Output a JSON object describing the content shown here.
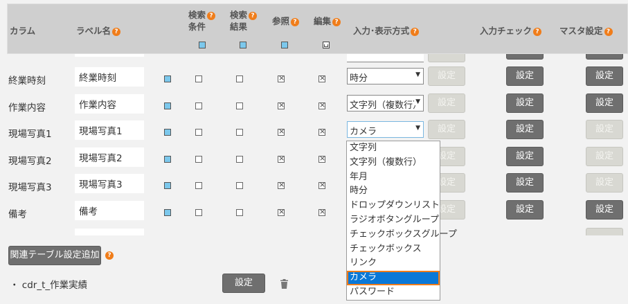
{
  "header": {
    "column": "カラム",
    "label_name": "ラベル名",
    "search_condition": [
      "検索",
      "条件"
    ],
    "search_result": [
      "検索",
      "結果"
    ],
    "reference": "参照",
    "edit": "編集",
    "input_display": "入力･表示方式",
    "input_check": "入力チェック",
    "master_setting": "マスタ設定",
    "help": "?"
  },
  "rows": [
    {
      "column": "終業時刻",
      "label": "終業時刻",
      "type": "時分",
      "setting_enabled": false,
      "input_check_enabled": true,
      "master_enabled": true
    },
    {
      "column": "作業内容",
      "label": "作業内容",
      "type": "文字列（複数行）",
      "setting_enabled": false,
      "input_check_enabled": true,
      "master_enabled": true
    },
    {
      "column": "現場写真1",
      "label": "現場写真1",
      "type": "カメラ",
      "setting_enabled": false,
      "input_check_enabled": true,
      "master_enabled": false
    },
    {
      "column": "現場写真2",
      "label": "現場写真2",
      "type": "",
      "setting_enabled": false,
      "input_check_enabled": true,
      "master_enabled": false
    },
    {
      "column": "現場写真3",
      "label": "現場写真3",
      "type": "",
      "setting_enabled": false,
      "input_check_enabled": true,
      "master_enabled": false
    },
    {
      "column": "備考",
      "label": "備考",
      "type": "",
      "setting_enabled": false,
      "input_check_enabled": true,
      "master_enabled": true
    }
  ],
  "button_label": "設定",
  "dropdown": {
    "options": [
      "文字列",
      "文字列（複数行）",
      "年月",
      "時分",
      "ドロップダウンリスト",
      "ラジオボタングループ",
      "チェックボックスグループ",
      "チェックボックス",
      "リンク",
      "カメラ",
      "パスワード"
    ],
    "selected": "カメラ"
  },
  "add_related_table": "関連テーブル設定追加",
  "related_table": {
    "name": "・ cdr_t_作業実績",
    "button": "設定"
  },
  "colors": {
    "accent": "#f07d1a",
    "highlight": "#0a78d7",
    "dark_button": "#6f6f6f"
  }
}
